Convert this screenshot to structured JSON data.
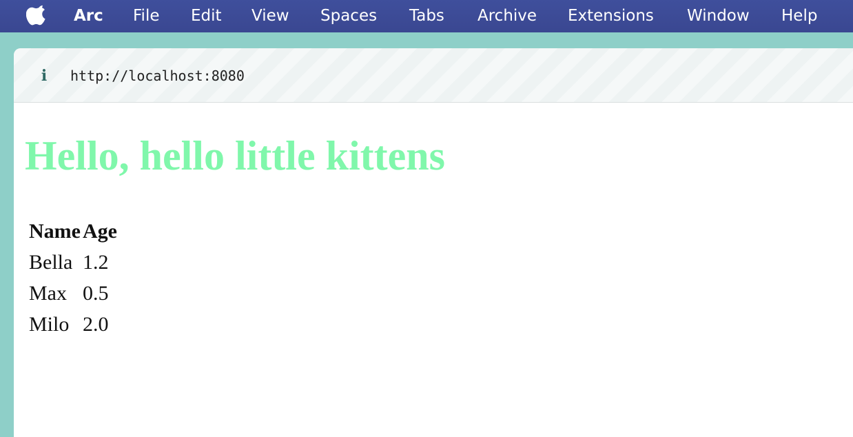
{
  "menubar": {
    "apple_icon": "apple-logo-icon",
    "app_name": "Arc",
    "items": [
      "File",
      "Edit",
      "View",
      "Spaces",
      "Tabs",
      "Archive",
      "Extensions",
      "Window",
      "Help"
    ]
  },
  "browser": {
    "info_icon": "info-icon",
    "info_glyph": "i",
    "url": "http://localhost:8080"
  },
  "page": {
    "heading": "Hello, hello little kittens",
    "heading_color": "#80f7ab",
    "table": {
      "headers": [
        "Name",
        "Age"
      ],
      "rows": [
        [
          "Bella",
          "1.2"
        ],
        [
          "Max",
          "0.5"
        ],
        [
          "Milo",
          "2.0"
        ]
      ]
    }
  },
  "colors": {
    "menubar": "#3f4f9c",
    "window_frame": "#8ecfc8",
    "url_icon": "#2f6964"
  }
}
